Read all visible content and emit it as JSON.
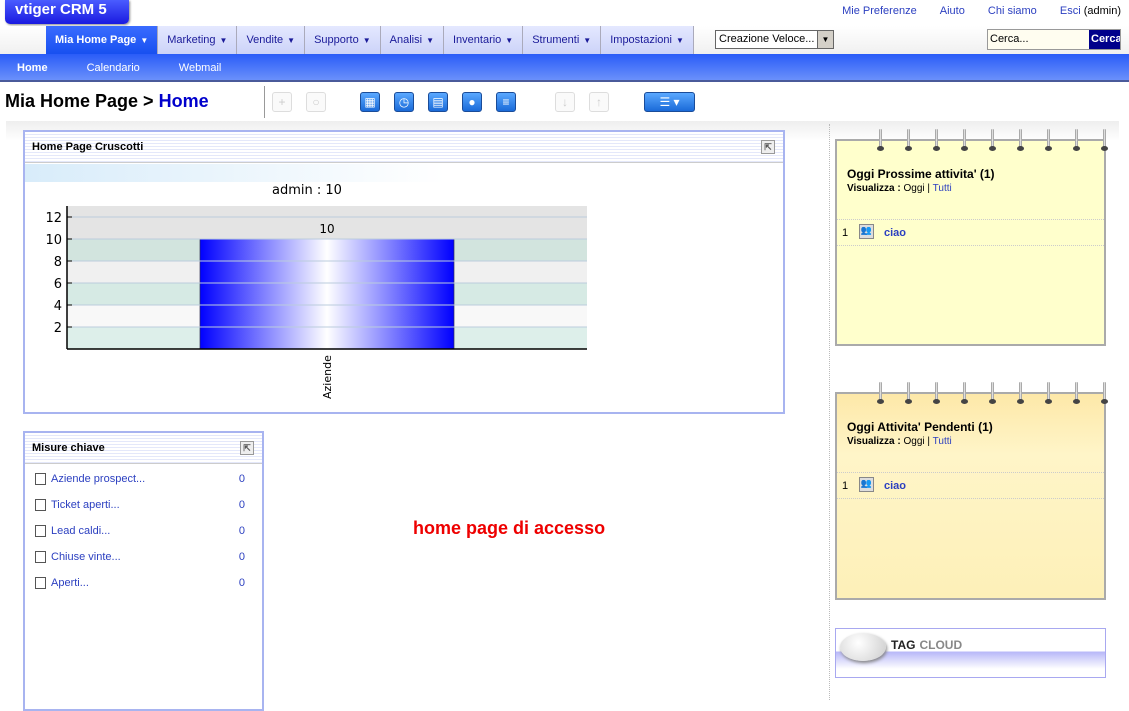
{
  "logo": "vtiger CRM 5",
  "toplinks": {
    "prefs": "Mie Preferenze",
    "help": "Aiuto",
    "about": "Chi siamo",
    "logout": "Esci",
    "user": "(admin)"
  },
  "tabs": [
    {
      "label": "Mia Home Page",
      "active": true
    },
    {
      "label": "Marketing"
    },
    {
      "label": "Vendite"
    },
    {
      "label": "Supporto"
    },
    {
      "label": "Analisi"
    },
    {
      "label": "Inventario"
    },
    {
      "label": "Strumenti"
    },
    {
      "label": "Impostazioni"
    }
  ],
  "quick_create": "Creazione Veloce...",
  "search": {
    "placeholder": "Cerca...",
    "button": "Cerca"
  },
  "subnav": [
    "Home",
    "Calendario",
    "Webmail"
  ],
  "breadcrumb": {
    "module": "Mia Home Page >",
    "page": "Home"
  },
  "toolbar_icons": [
    "add-icon",
    "search-icon",
    "calendar-icon",
    "clock-icon",
    "calculator-icon",
    "chat-icon",
    "notes-icon",
    "import-icon",
    "export-icon",
    "layout-icon"
  ],
  "dashboard": {
    "title": "Home Page Cruscotti"
  },
  "chart_data": {
    "type": "bar",
    "title": "admin : 10",
    "categories": [
      "Aziende"
    ],
    "values": [
      10
    ],
    "data_labels": [
      "10"
    ],
    "yticks": [
      2,
      4,
      6,
      8,
      10,
      12
    ],
    "ylim": [
      0,
      13
    ],
    "xlabel": "",
    "ylabel": "",
    "bar_color": "#0000ff",
    "grid": true
  },
  "key_metrics": {
    "title": "Misure chiave",
    "items": [
      {
        "label": "Aziende prospect...",
        "value": "0"
      },
      {
        "label": "Ticket aperti...",
        "value": "0"
      },
      {
        "label": "Lead caldi...",
        "value": "0"
      },
      {
        "label": "Chiuse vinte...",
        "value": "0"
      },
      {
        "label": "Aperti...",
        "value": "0"
      }
    ]
  },
  "message": "home page di accesso",
  "upcoming": {
    "title": "Oggi Prossime attivita' (1)",
    "view_label": "Visualizza :",
    "today": "Oggi",
    "sep": "|",
    "all": "Tutti",
    "rows": [
      {
        "n": "1",
        "name": "ciao"
      }
    ]
  },
  "pending": {
    "title": "Oggi Attivita' Pendenti (1)",
    "view_label": "Visualizza :",
    "today": "Oggi",
    "sep": "|",
    "all": "Tutti",
    "rows": [
      {
        "n": "1",
        "name": "ciao"
      }
    ]
  },
  "tagcloud": {
    "tag": "TAG",
    "cloud": "CLOUD"
  }
}
